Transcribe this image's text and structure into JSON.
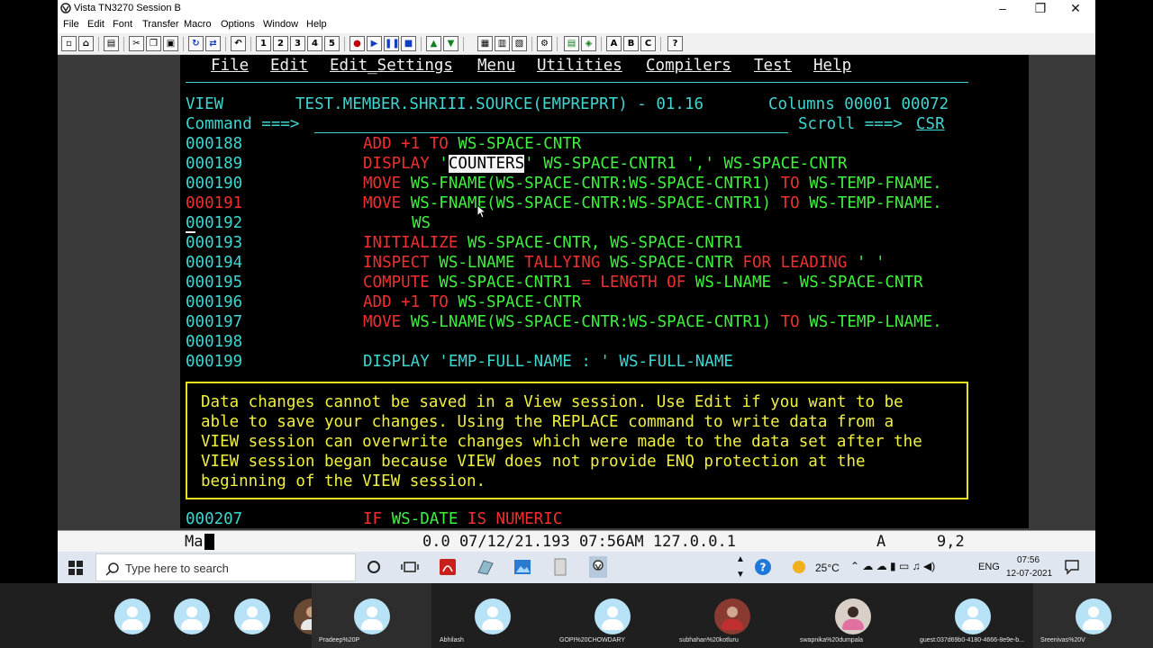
{
  "window": {
    "title": "Vista TN3270 Session B",
    "minimize": "–",
    "restore": "❐",
    "close": "✕"
  },
  "menubar": {
    "items": [
      "File",
      "Edit",
      "Font",
      "Transfer",
      "Macro",
      "Options",
      "Window",
      "Help"
    ]
  },
  "toolbar": {
    "n1": "1",
    "n2": "2",
    "n3": "3",
    "n4": "4",
    "n5": "5",
    "a": "A",
    "b": "B",
    "c": "C",
    "q": "?"
  },
  "terminal": {
    "menu": [
      "File",
      "Edit",
      "Edit_Settings",
      "Menu",
      "Utilities",
      "Compilers",
      "Test",
      "Help"
    ],
    "header": {
      "mode": "VIEW",
      "dataset": "TEST.MEMBER.SHRIII.SOURCE(EMPREPRT) - 01.16",
      "columns": "Columns 00001 00072"
    },
    "command_label": "Command ===>",
    "command_value": "",
    "scroll_label": "Scroll ===>",
    "scroll_value": "CSR",
    "lines": {
      "l188": {
        "num": "000188",
        "kw1": "ADD +1 ",
        "kw2": "TO ",
        "var": "WS-SPACE-CNTR"
      },
      "l189": {
        "num": "000189",
        "kw": "DISPLAY ",
        "q1": "'",
        "hl": "COUNTERS",
        "rest": "' WS-SPACE-CNTR1 ',' WS-SPACE-CNTR"
      },
      "l190": {
        "num": "000190",
        "kw": "MOVE ",
        "a": "WS-FNAME(WS-SPACE-CNTR:WS-SPACE-CNTR1) ",
        "to": "TO ",
        "b": "WS-TEMP-FNAME."
      },
      "l191": {
        "num": "000191",
        "kw": "MOVE ",
        "a": "WS-FNAME(WS-SPACE-CNTR:WS-SPACE-CNTR1) ",
        "to": "TO ",
        "b": "WS-TEMP-FNAME."
      },
      "l192": {
        "num": "000192",
        "text": "WS"
      },
      "l193": {
        "num": "000193",
        "kw": "INITIALIZE ",
        "rest": "WS-SPACE-CNTR, WS-SPACE-CNTR1"
      },
      "l194": {
        "num": "000194",
        "kw": "INSPECT ",
        "a": "WS-LNAME ",
        "k2": "TALLYING ",
        "b": "WS-SPACE-CNTR ",
        "k3": "FOR LEADING ",
        "c": "' '"
      },
      "l195": {
        "num": "000195",
        "kw": "COMPUTE ",
        "a": "WS-SPACE-CNTR1 ",
        "k2": "= LENGTH OF ",
        "b": "WS-LNAME - WS-SPACE-CNTR"
      },
      "l196": {
        "num": "000196",
        "kw1": "ADD +1 ",
        "kw2": "TO ",
        "var": "WS-SPACE-CNTR"
      },
      "l197": {
        "num": "000197",
        "kw": "MOVE ",
        "a": "WS-LNAME(WS-SPACE-CNTR:WS-SPACE-CNTR1) ",
        "to": "TO ",
        "b": "WS-TEMP-LNAME."
      },
      "l198": {
        "num": "000198"
      },
      "l199": {
        "num": "000199",
        "text": "DISPLAY 'EMP-FULL-NAME : ' WS-FULL-NAME"
      },
      "l207": {
        "num": "000207",
        "kw": "IF ",
        "a": "WS-DATE ",
        "k2": "IS NUMERIC"
      }
    },
    "message": [
      "Data changes cannot be saved in a View session. Use Edit if you want to be",
      "able to save your changes. Using the REPLACE command to write data from a",
      "VIEW session can overwrite changes which were made to the data set after the",
      "VIEW session began because VIEW does not provide ENQ protection at the",
      "beginning of the VIEW session."
    ]
  },
  "statusbar": {
    "input": "Ma",
    "info": "0.0 07/12/21.193 07:56AM 127.0.0.1",
    "mode": "A",
    "pos": "9,2"
  },
  "taskbar": {
    "search_placeholder": "Type here to search",
    "weather": "25°C",
    "lang": "ENG",
    "time": "07:56",
    "date": "12-07-2021"
  },
  "participants": [
    {
      "name": ""
    },
    {
      "name": ""
    },
    {
      "name": ""
    },
    {
      "name": ""
    },
    {
      "name": ""
    },
    {
      "name": "Pradeep%20P"
    },
    {
      "name": "Abhilash"
    },
    {
      "name": "GOPI%20CHOWDARY"
    },
    {
      "name": "subhahan%20kotluru"
    },
    {
      "name": "swapnika%20dumpala"
    },
    {
      "name": "guest:037d69b0-4180-4666-8e9e-b..."
    },
    {
      "name": "Sreenivas%20V"
    }
  ],
  "colors": {
    "line_number": "#3fd5d0",
    "keyword": "#f03030",
    "identifier": "#40f040",
    "message": "#f0f040",
    "menu_text": "#f0f0f0"
  }
}
